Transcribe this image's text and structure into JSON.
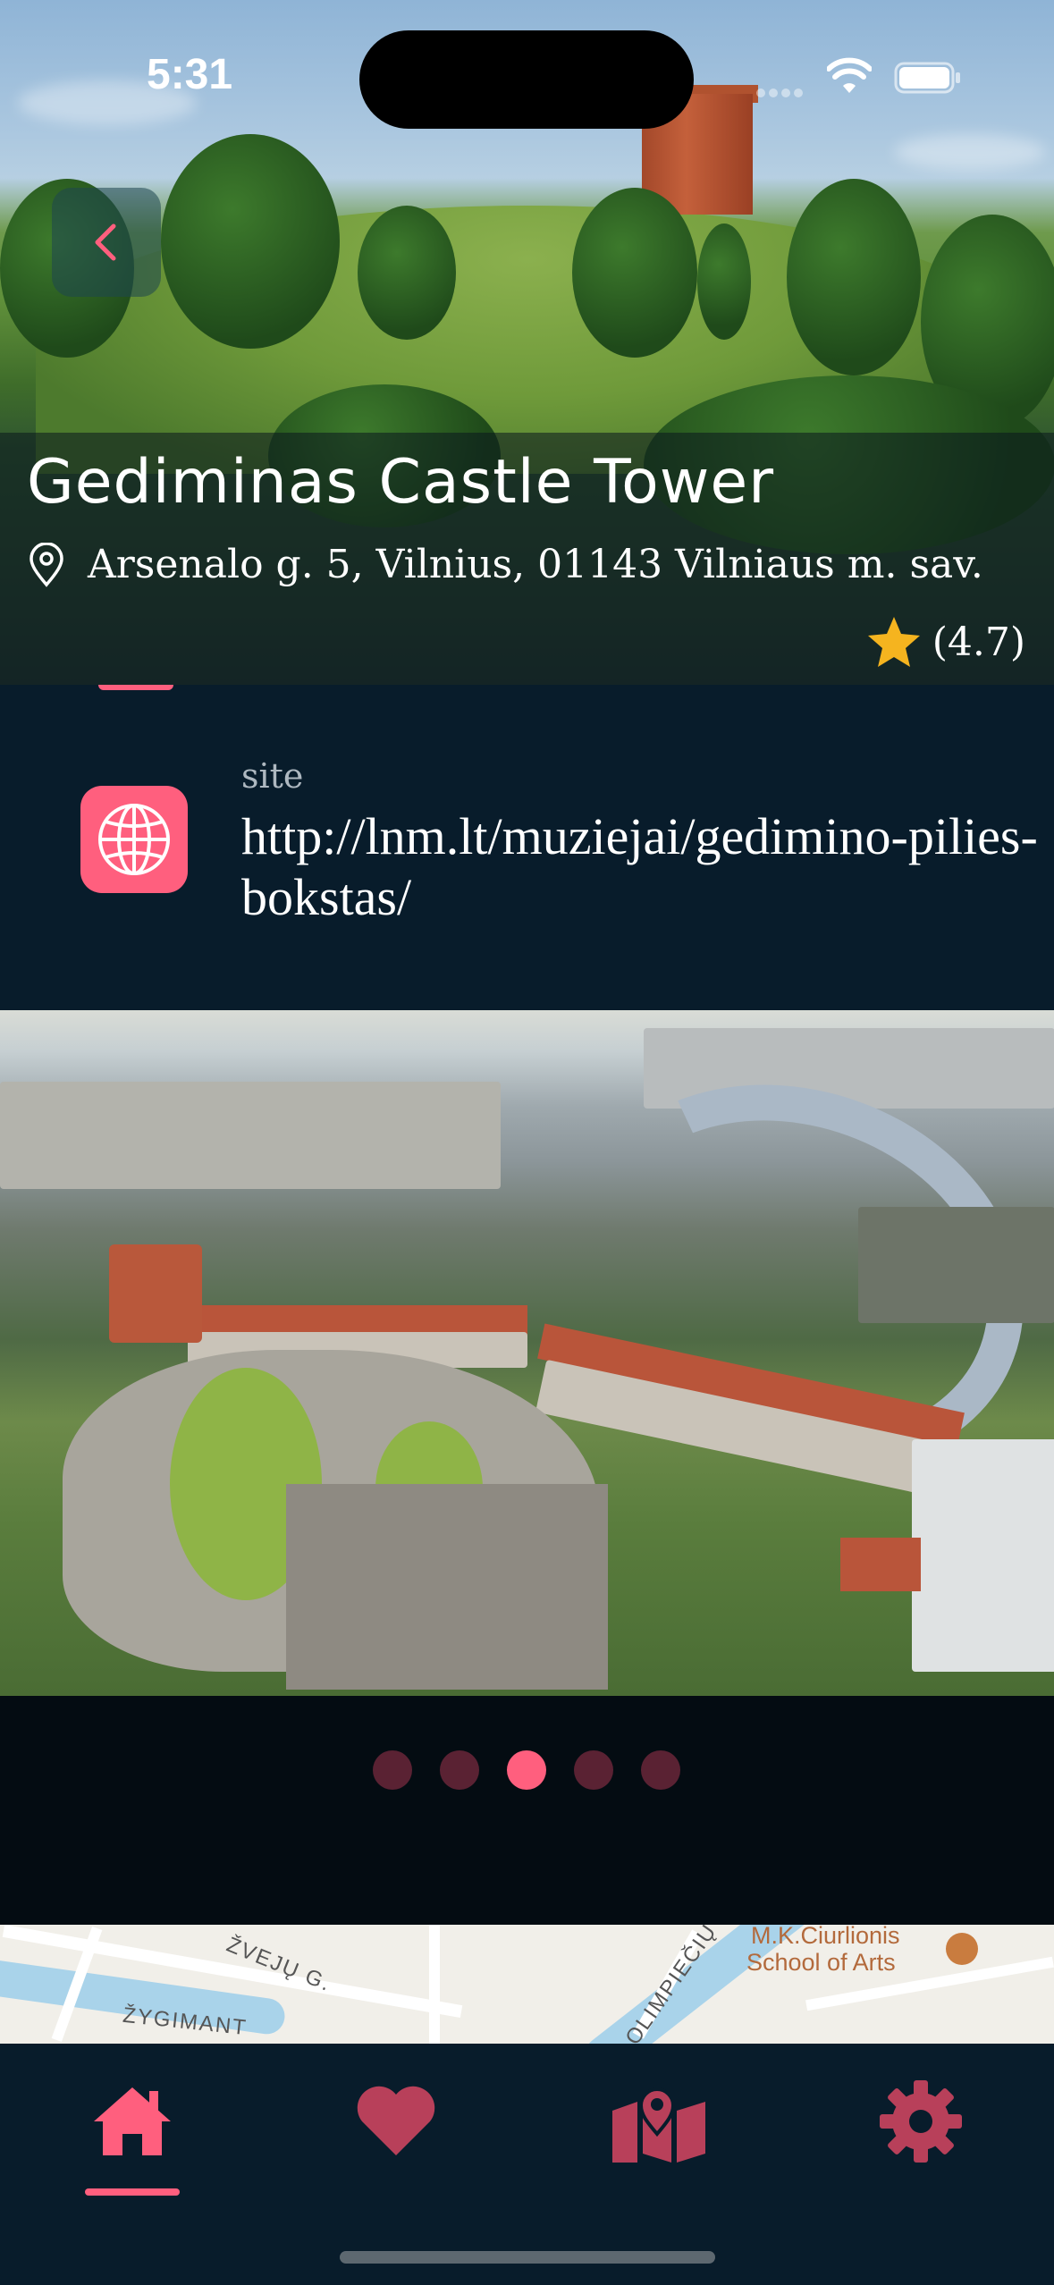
{
  "status_bar": {
    "time": "5:31"
  },
  "place": {
    "title": "Gediminas Castle Tower",
    "address": "Arsenalo g. 5, Vilnius, 01143 Vilniaus m. sav.",
    "rating": "(4.7)"
  },
  "site": {
    "label": "site",
    "url": "http://lnm.lt/muziejai/gedimino-pilies-bokstas/"
  },
  "gallery": {
    "page_count": 5,
    "active_index": 2
  },
  "map": {
    "street_1": "ŽVEJŲ G.",
    "street_2": "ŽYGIMANT",
    "street_3": "OLIMPIEČIŲ",
    "poi_line_1": "M.K.Ciurlionis",
    "poi_line_2": "School of Arts"
  },
  "tabs": [
    "home-icon",
    "heart-icon",
    "map-icon",
    "gear-icon"
  ],
  "colors": {
    "accent": "#ff5f7e",
    "panel": "#081c2b",
    "inactive_icon": "#b8405a"
  }
}
